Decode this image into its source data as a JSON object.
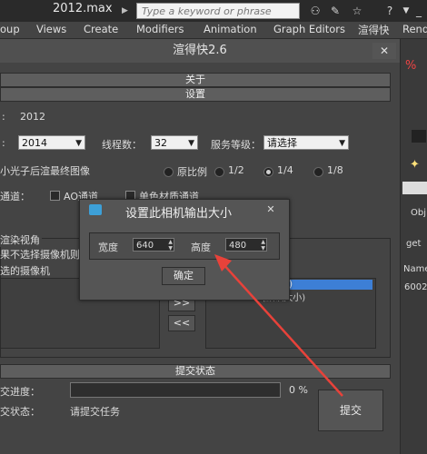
{
  "titlebar": {
    "file": "2012.max",
    "search_placeholder": "Type a keyword or phrase"
  },
  "menubar": [
    "oup",
    "Views",
    "Create",
    "Modifiers",
    "Animation",
    "Graph Editors",
    "渲得快",
    "Rend"
  ],
  "plugin": {
    "title": "渲得快2.6",
    "about": "关于",
    "settings": "设置",
    "version_value": "2012",
    "year_select": "2014",
    "threads_label": "线程数：",
    "threads_value": "32",
    "service_label": "服务等级：",
    "service_value": "请选择",
    "render_opt_label": "小光子后渲最终图像",
    "ratio": {
      "orig": "原比例",
      "half": "1/2",
      "quarter": "1/4",
      "eighth": "1/8"
    },
    "channel_label": "通道：",
    "ao_label": "AO通道",
    "single_mat_label": "单色材质通道",
    "view_group": "渲染视角",
    "view_hint": "果不选择摄像机则",
    "selected_cams": "选的摄像机",
    "list_right_0": "小)",
    "list_right_1": "Camera001(默认大小)",
    "btn_right": ">>",
    "btn_left": "<<",
    "submit_status_title": "提交状态",
    "progress_label": "交进度：",
    "progress_value": "0 %",
    "status_label": "交状态：",
    "status_value": "请提交任务",
    "submit_button": "提交"
  },
  "dialog": {
    "title": "设置此相机输出大小",
    "width_label": "宽度",
    "width_value": "640",
    "height_label": "高度",
    "height_value": "480",
    "ok_button": "确定"
  },
  "side": {
    "obj": "Obj",
    "get": "get",
    "name": "Name",
    "num": "6002"
  },
  "colors": {
    "annotation_arrow": "#e8423a",
    "list_selection": "#3d7fd6"
  }
}
